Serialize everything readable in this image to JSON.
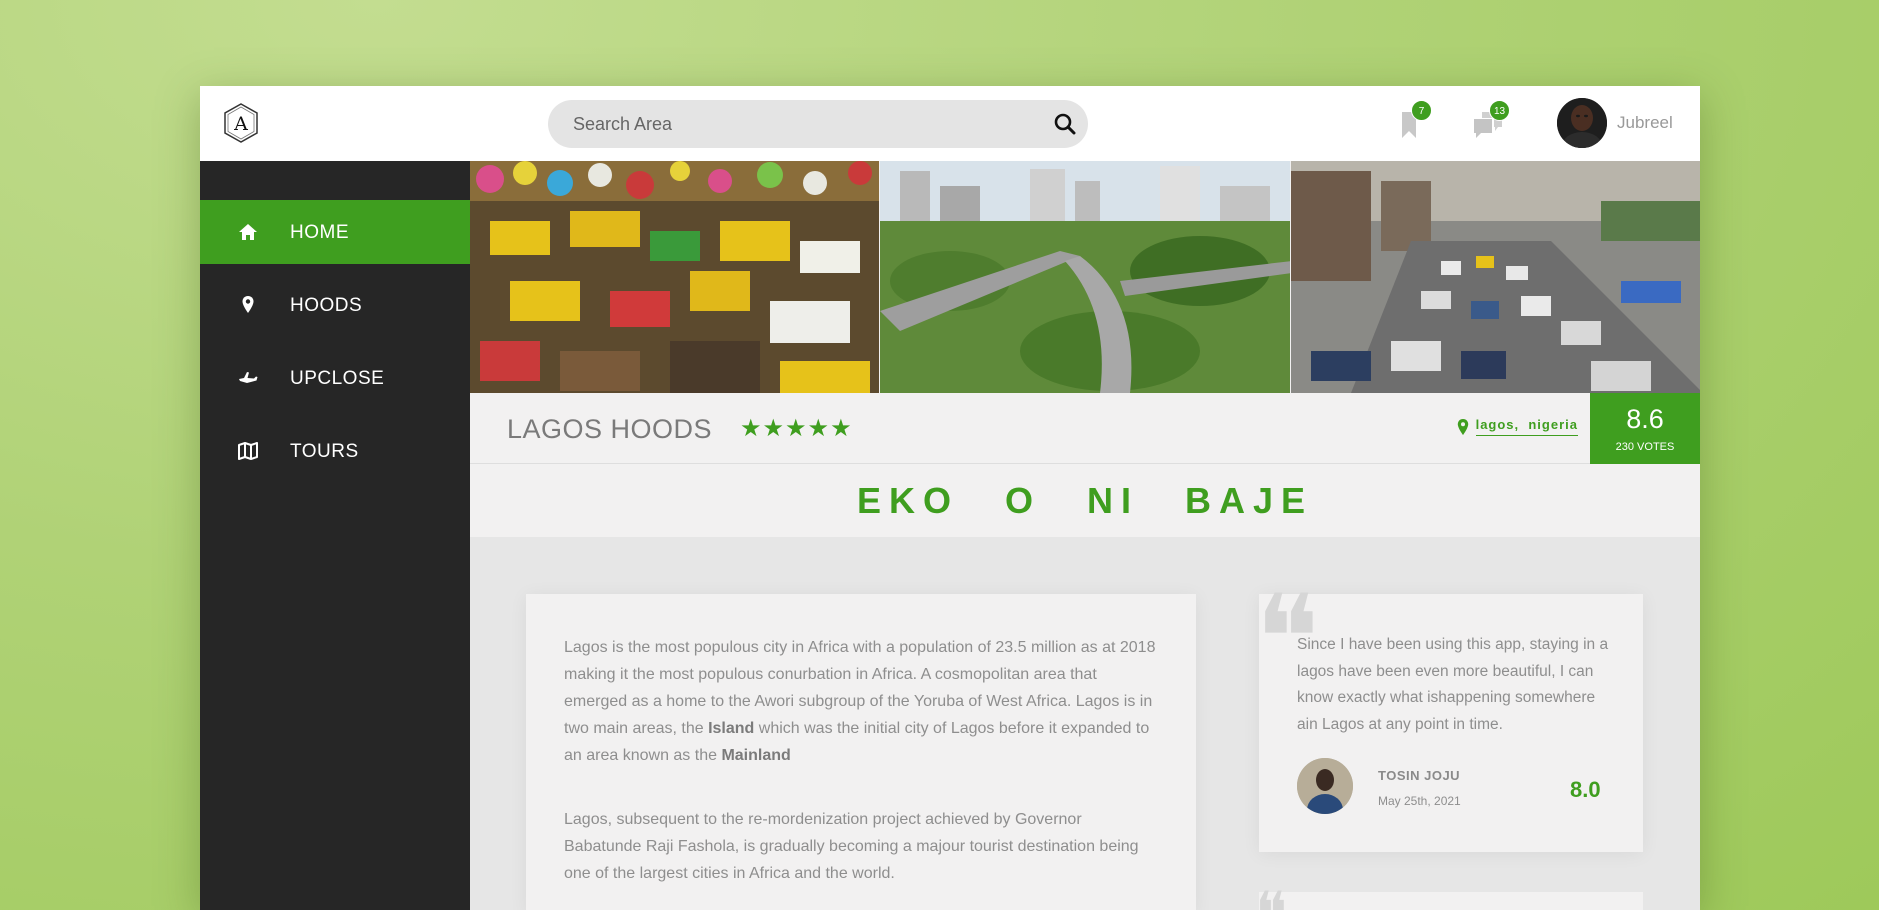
{
  "header": {
    "search_placeholder": "Search Area",
    "bookmarks_count": "7",
    "messages_count": "13",
    "username": "Jubreel"
  },
  "sidebar": {
    "items": [
      {
        "label": "HOME",
        "icon": "home-icon",
        "active": true
      },
      {
        "label": "HOODS",
        "icon": "map-pin-icon",
        "active": false
      },
      {
        "label": "UPCLOSE",
        "icon": "airplane-icon",
        "active": false
      },
      {
        "label": "TOURS",
        "icon": "map-icon",
        "active": false
      }
    ]
  },
  "place": {
    "title": "LAGOS HOODS",
    "stars": "★★★★★",
    "rating_stars": 5,
    "location": "lagos,  nigeria",
    "score": "8.6",
    "votes": "230 VOTES"
  },
  "slogan": "EKO O NI BAJE",
  "article": {
    "p1_a": "Lagos is the most populous city in Africa with a population of 23.5 million as at 2018 making it the most populous conurbation in Africa. A cosmopolitan area that emerged as a home to the Awori subgroup of the Yoruba of West Africa. Lagos is in two main areas, the ",
    "p1_bold1": "Island",
    "p1_b": " which was the initial city of Lagos before it expanded to an area known as the ",
    "p1_bold2": "Mainland",
    "p2": "Lagos, subsequent to the re-mordenization project achieved by Governor Babatunde Raji Fashola, is gradually becoming a majour tourist destination being one of the largest cities in Africa and the world."
  },
  "review": {
    "text": "Since I have been using this app, staying in a lagos have been even more beautiful, I can know exactly what ishappening somewhere ain Lagos at any point in time.",
    "name": "TOSIN JOJU",
    "date": "May 25th, 2021",
    "score": "8.0"
  },
  "colors": {
    "accent": "#3f9e1f",
    "sidebar_bg": "#262626",
    "page_bg": "#b0d276"
  }
}
